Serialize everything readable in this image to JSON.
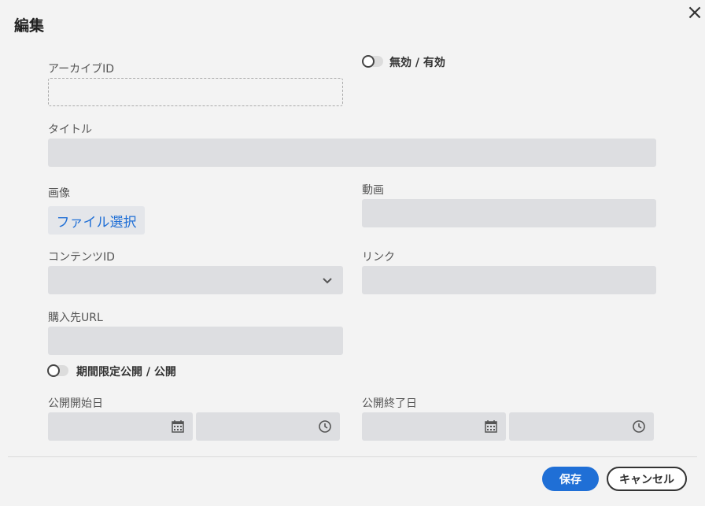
{
  "dialog": {
    "title": "編集",
    "close_icon": "×"
  },
  "form": {
    "archive_id_label": "アーカイブID",
    "archive_id_value": "",
    "enable_toggle_label": "無効 / 有効",
    "enable_toggle_on": false,
    "title_label": "タイトル",
    "title_value": "",
    "image_label": "画像",
    "file_select_label": "ファイル選択",
    "video_label": "動画",
    "video_value": "",
    "content_id_label": "コンテンツID",
    "content_id_value": "",
    "link_label": "リンク",
    "link_value": "",
    "purchase_url_label": "購入先URL",
    "purchase_url_value": "",
    "period_toggle_label": "期間限定公開 / 公開",
    "period_toggle_on": false,
    "start_date_label": "公開開始日",
    "end_date_label": "公開終了日"
  },
  "footer": {
    "save_label": "保存",
    "cancel_label": "キャンセル"
  },
  "colors": {
    "accent": "#1f6fd6",
    "field_bg": "#dddee1",
    "page_bg": "#f3f3f3"
  },
  "icons": {
    "close": "close-icon",
    "chevron": "chevron-down-icon",
    "calendar": "calendar-icon",
    "clock": "clock-icon"
  }
}
